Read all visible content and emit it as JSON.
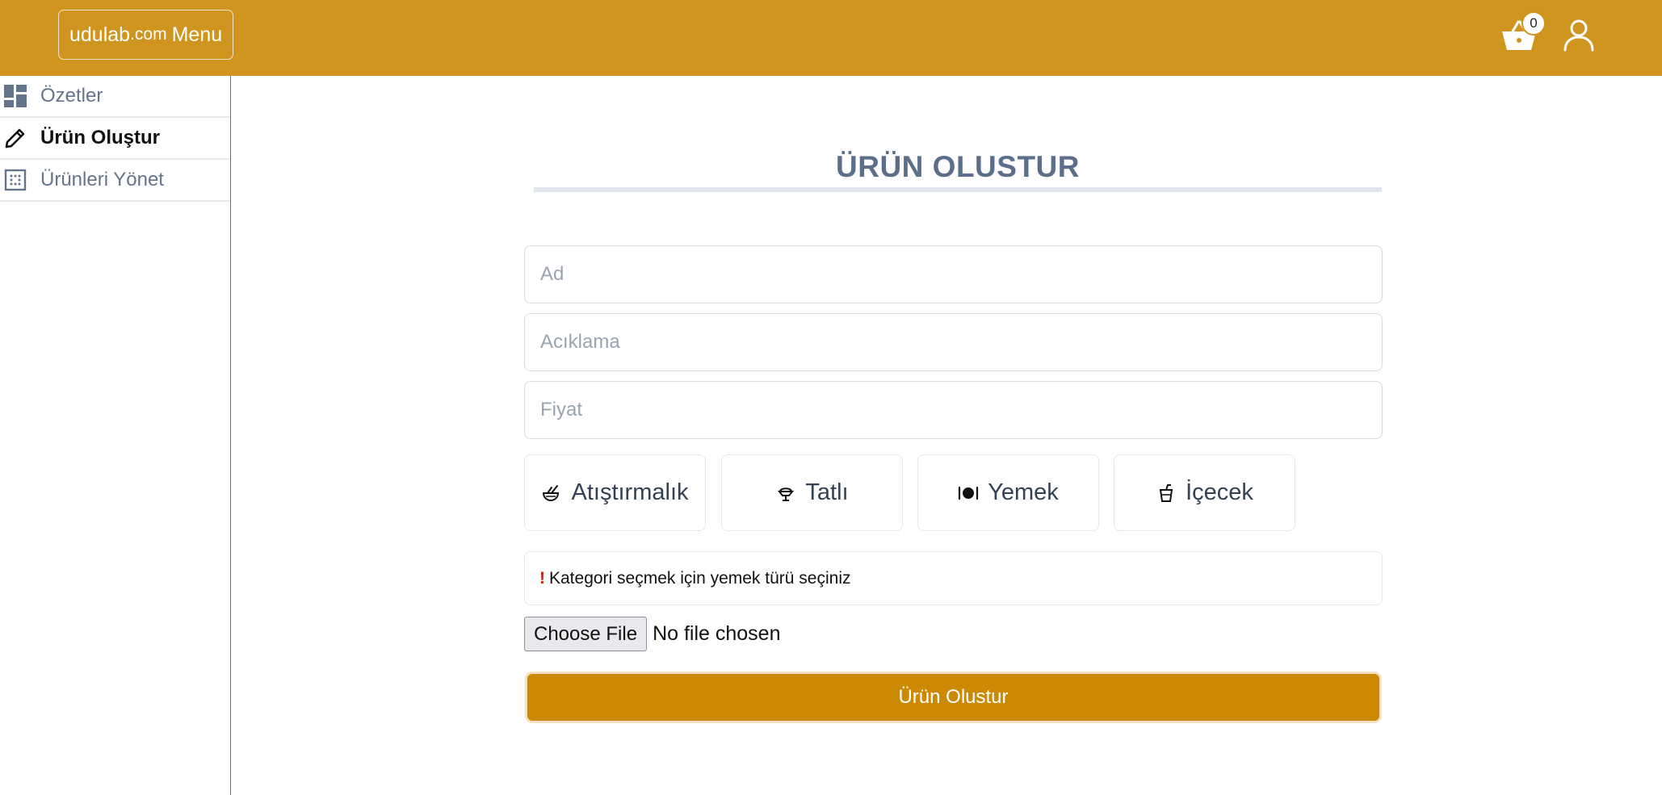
{
  "header": {
    "brand": {
      "part1": "udulab",
      "part2": ".com",
      "part3": "Menu"
    },
    "cart": {
      "icon": "basket-icon",
      "count": "0"
    },
    "user": {
      "icon": "user-icon"
    }
  },
  "sidebar": {
    "items": [
      {
        "label": "Özetler",
        "icon": "dashboard-icon",
        "active": false
      },
      {
        "label": "Ürün Oluştur",
        "icon": "pencil-icon",
        "active": true
      },
      {
        "label": "Ürünleri Yönet",
        "icon": "grid-dots-icon",
        "active": false
      }
    ]
  },
  "main": {
    "title": "ÜRÜN OLUSTUR",
    "fields": {
      "name": {
        "placeholder": "Ad",
        "value": ""
      },
      "description": {
        "placeholder": "Acıklama",
        "value": ""
      },
      "price": {
        "placeholder": "Fiyat",
        "value": ""
      }
    },
    "categories": [
      {
        "label": "Atıştırmalık",
        "icon": "snack-bowl-icon"
      },
      {
        "label": "Tatlı",
        "icon": "ice-cream-icon"
      },
      {
        "label": "Yemek",
        "icon": "plate-cutlery-icon"
      },
      {
        "label": "İçecek",
        "icon": "drink-cup-icon"
      }
    ],
    "hint": {
      "mark": "!",
      "text": "Kategori seçmek için yemek türü seçiniz"
    },
    "file": {
      "button": "Choose File",
      "status": "No file chosen"
    },
    "submit": "Ürün Olustur"
  },
  "colors": {
    "header_bg": "#d0951e",
    "submit_bg": "#cb8904",
    "title_text": "#5b6e8c",
    "sidebar_text": "#64748b"
  }
}
